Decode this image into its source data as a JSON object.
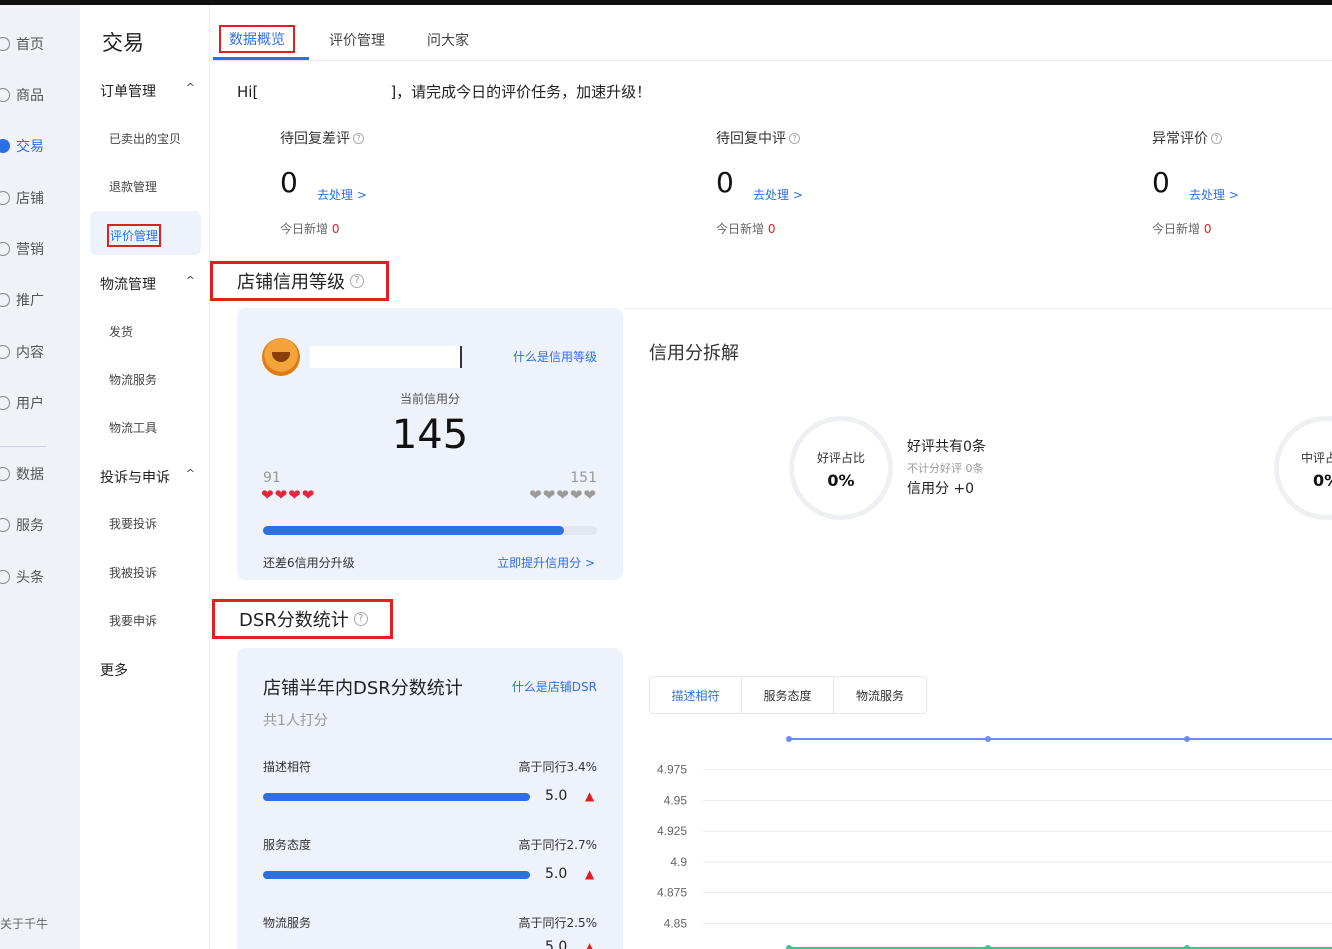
{
  "rail": {
    "items": [
      {
        "label": "首页"
      },
      {
        "label": "商品"
      },
      {
        "label": "交易"
      },
      {
        "label": "店铺"
      },
      {
        "label": "营销"
      },
      {
        "label": "推广"
      },
      {
        "label": "内容"
      },
      {
        "label": "用户"
      },
      {
        "label": "数据"
      },
      {
        "label": "服务"
      },
      {
        "label": "头条"
      }
    ],
    "active_index": 2,
    "footer": "关于千牛"
  },
  "subnav": {
    "title": "交易",
    "groups": [
      {
        "label": "订单管理",
        "caret": "^"
      },
      {
        "label": "物流管理",
        "caret": "^"
      },
      {
        "label": "投诉与申诉",
        "caret": "^"
      },
      {
        "label": "更多",
        "caret": ""
      }
    ],
    "leaves": [
      {
        "label": "已卖出的宝贝"
      },
      {
        "label": "退款管理"
      },
      {
        "label": "评价管理"
      },
      {
        "label": "发货"
      },
      {
        "label": "物流服务"
      },
      {
        "label": "物流工具"
      },
      {
        "label": "我要投诉"
      },
      {
        "label": "我被投诉"
      },
      {
        "label": "我要申诉"
      }
    ]
  },
  "tabs": [
    {
      "label": "数据概览"
    },
    {
      "label": "评价管理"
    },
    {
      "label": "问大家"
    }
  ],
  "greeting": {
    "prefix": "Hi[",
    "suffix": "]，请完成今日的评价任务，加速升级！"
  },
  "stats": [
    {
      "label": "待回复差评",
      "value": "0",
      "link": "去处理 >",
      "sub": "今日新增 ",
      "sub_value": "0"
    },
    {
      "label": "待回复中评",
      "value": "0",
      "link": "去处理 >",
      "sub": "今日新增 ",
      "sub_value": "0"
    },
    {
      "label": "异常评价",
      "value": "0",
      "link": "去处理 >",
      "sub": "今日新增 ",
      "sub_value": "0"
    }
  ],
  "credit_section": {
    "title": "店铺信用等级"
  },
  "credit": {
    "what_link": "什么是信用等级",
    "current_label": "当前信用分",
    "score": "145",
    "level_low": "91",
    "level_high": "151",
    "red_hearts": "❤❤❤❤",
    "gray_hearts": "❤❤❤❤❤",
    "progress": 0.9,
    "to_level": "还差6信用分升级",
    "improve_link": "立即提升信用分 >"
  },
  "breakdown": {
    "title": "信用分拆解",
    "good_ratio_label": "好评占比",
    "good_ratio_value": "0%",
    "good_total": "好评共有0条",
    "good_not_counted": "不计分好评 0条",
    "good_credit": "信用分 +0",
    "mid_ratio_label": "中评占",
    "mid_ratio_value": "0%"
  },
  "dsr_section": {
    "title": "DSR分数统计"
  },
  "dsr": {
    "title": "店铺半年内DSR分数统计",
    "what_link": "什么是店铺DSR",
    "raters": "共1人打分",
    "rows": [
      {
        "label": "描述相符",
        "compare": "高于同行3.4%",
        "score": "5.0",
        "arrow": "▲"
      },
      {
        "label": "服务态度",
        "compare": "高于同行2.7%",
        "score": "5.0",
        "arrow": "▲"
      },
      {
        "label": "物流服务",
        "compare": "高于同行2.5%",
        "score": "5.0",
        "arrow": "▲"
      }
    ]
  },
  "dsr_tabs": [
    {
      "label": "描述相符"
    },
    {
      "label": "服务态度"
    },
    {
      "label": "物流服务"
    }
  ],
  "chart_data": {
    "type": "line",
    "y_ticks": [
      "4.975",
      "4.95",
      "4.925",
      "4.9",
      "4.875",
      "4.85"
    ],
    "ylim": [
      4.83,
      5.0
    ],
    "series": [
      {
        "values": [
          5.0,
          5.0,
          5.0,
          5.0
        ],
        "color": "#6b8ff0"
      },
      {
        "values": [
          4.83,
          4.83,
          4.83,
          4.83
        ],
        "color": "#3ec48a"
      }
    ],
    "grid": true
  },
  "colors": {
    "accent": "#2f6fe4",
    "highlight_box": "#e02020"
  }
}
